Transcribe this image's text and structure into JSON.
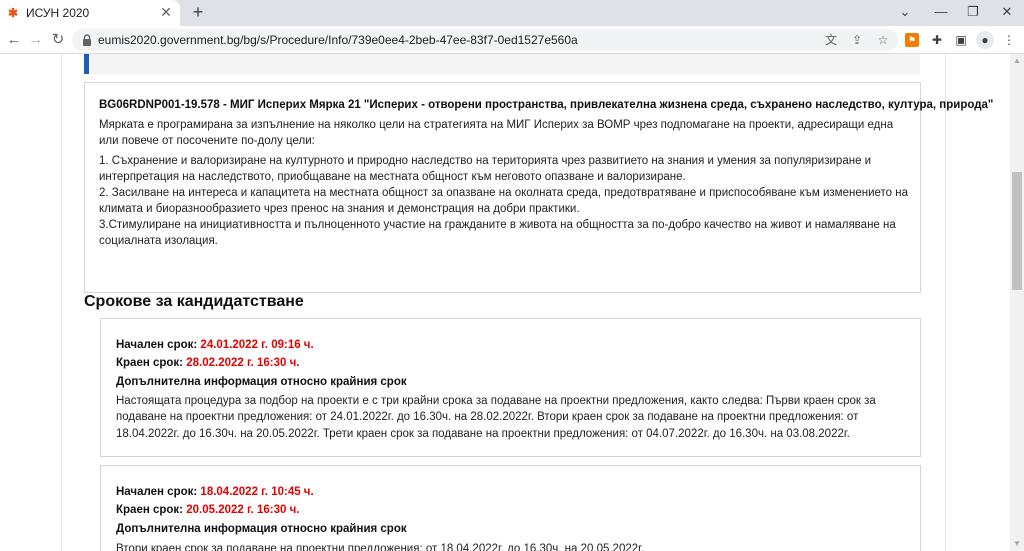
{
  "browser": {
    "tab_title": "ИСУН 2020",
    "tab_close": "✕",
    "new_tab": "+",
    "url": "eumis2020.government.bg/bg/s/Procedure/Info/739e0ee4-2beb-47ee-83f7-0ed1527e560a",
    "controls": {
      "minimize": "—",
      "restore": "❐",
      "close": "✕",
      "tab_search": "⌄"
    },
    "nav": {
      "back": "←",
      "forward": "→",
      "reload": "↻"
    }
  },
  "description": {
    "title": "BG06RDNP001-19.578 - МИГ Исперих Мярка 21 \"Исперих - отворени пространства, привлекателна жизнена среда, съхранено наследство, култура, природа\"",
    "paragraphs": [
      "Мярката е програмирана за изпълнение на няколко цели на стратегията на МИГ Исперих за ВОМР чрез подпомагане на проекти, адресиращи една или повече от посочените по-долу цели:",
      "1. Съхранение и валоризиране на културното и природно наследство на територията чрез развитието на знания и умения за популяризиране и интерпретация на наследството, приобщаване на местната общност към неговото опазване и валоризиране.",
      "2. Засилване на интереса и капацитета на местната общност за опазване на околната среда, предотвратяване и приспособяване към изменението на климата и биоразнообразието чрез пренос на знания и демонстрация на добри практики.",
      "3.Стимулиране на инициативността и пълноценното участие на гражданите в живота на общността за по-добро качество на живот и намаляване на социалната изолация."
    ]
  },
  "deadlines": {
    "heading": "Срокове за кандидатстване",
    "labels": {
      "start": "Начален срок:",
      "end": "Краен срок:",
      "extra": "Допълнителна информация относно крайния срок"
    },
    "items": [
      {
        "start": "24.01.2022 г. 09:16 ч.",
        "end": "28.02.2022 г. 16:30 ч.",
        "info": "Настоящата процедура за подбор на проекти е с три крайни срока за подаване на проектни предложения, както следва: Първи краен срок за подаване на проектни предложения: от 24.01.2022г. до 16.30ч. на 28.02.2022г. Втори краен срок за подаване на проектни предложения: от 18.04.2022г. до 16.30ч. на 20.05.2022г. Трети краен срок за подаване на проектни предложения: от 04.07.2022г. до 16.30ч. на 03.08.2022г."
      },
      {
        "start": "18.04.2022 г. 10:45 ч.",
        "end": "20.05.2022 г. 16:30 ч.",
        "info": "Втори краен срок за подаване на проектни предложения: от 18.04.2022г. до 16.30ч. на 20.05.2022г."
      }
    ]
  }
}
